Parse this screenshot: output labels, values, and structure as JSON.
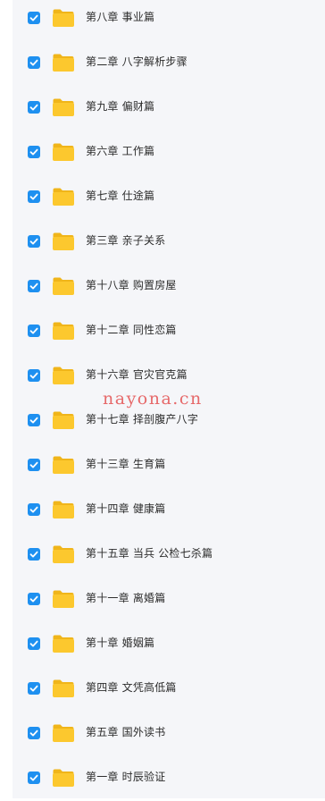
{
  "folders": [
    {
      "name": "第八章 事业篇",
      "checked": true
    },
    {
      "name": "第二章 八字解析步骤",
      "checked": true
    },
    {
      "name": "第九章 偏财篇",
      "checked": true
    },
    {
      "name": "第六章 工作篇",
      "checked": true
    },
    {
      "name": "第七章 仕途篇",
      "checked": true
    },
    {
      "name": "第三章 亲子关系",
      "checked": true
    },
    {
      "name": "第十八章 购置房屋",
      "checked": true
    },
    {
      "name": "第十二章 同性恋篇",
      "checked": true
    },
    {
      "name": "第十六章 官灾官克篇",
      "checked": true
    },
    {
      "name": "第十七章 择剖腹产八字",
      "checked": true
    },
    {
      "name": "第十三章 生育篇",
      "checked": true
    },
    {
      "name": "第十四章 健康篇",
      "checked": true
    },
    {
      "name": "第十五章 当兵 公检七杀篇",
      "checked": true
    },
    {
      "name": "第十一章 离婚篇",
      "checked": true
    },
    {
      "name": "第十章 婚姻篇",
      "checked": true
    },
    {
      "name": "第四章 文凭高低篇",
      "checked": true
    },
    {
      "name": "第五章 国外读书",
      "checked": true
    },
    {
      "name": "第一章 时辰验证",
      "checked": true
    }
  ],
  "watermark": "nayona.cn",
  "colors": {
    "checkbox": "#1e90f0",
    "folder_body": "#fcc82e",
    "folder_tab": "#f0b51a",
    "panel_bg": "#f5f6f9",
    "text": "#2c2c2c",
    "watermark": "#e03232"
  },
  "icons": {
    "checkbox": "check-icon",
    "folder": "folder-icon"
  }
}
